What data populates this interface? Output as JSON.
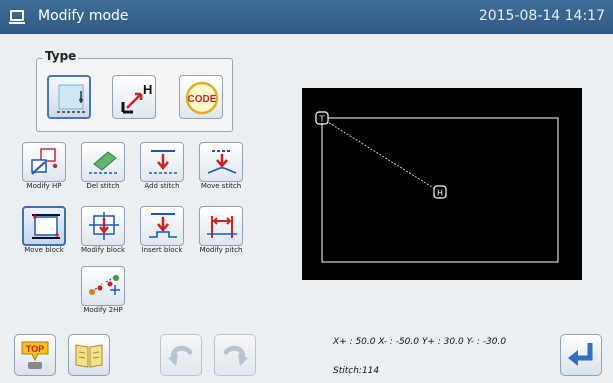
{
  "header": {
    "title": "Modify mode",
    "datetime": "2015-08-14 14:17"
  },
  "type_group": {
    "legend": "Type",
    "buttons": [
      {
        "icon": "stitch-data-icon",
        "selected": true
      },
      {
        "icon": "high-low-icon",
        "label": "H"
      },
      {
        "icon": "code-icon",
        "label": "CODE"
      }
    ]
  },
  "functions": [
    {
      "label": "Modify HP",
      "icon": "modify-hp-icon"
    },
    {
      "label": "Del stitch",
      "icon": "del-stitch-icon"
    },
    {
      "label": "Add stitch",
      "icon": "add-stitch-icon"
    },
    {
      "label": "Move stitch",
      "icon": "move-stitch-icon"
    },
    {
      "label": "Move block",
      "icon": "move-block-icon",
      "selected": true
    },
    {
      "label": "Modify block",
      "icon": "modify-block-icon"
    },
    {
      "label": "Insert block",
      "icon": "insert-block-icon"
    },
    {
      "label": "Modify pitch",
      "icon": "modify-pitch-icon"
    },
    {
      "label": "Modify 2HP",
      "icon": "modify-2hp-icon"
    }
  ],
  "preview": {
    "start_marker": "T",
    "end_marker": "H"
  },
  "stats": {
    "coords": "X+ : 50.0   X- : -50.0   Y+ : 30.0   Y- : -30.0",
    "stitch": "Stitch:114"
  },
  "bottom": {
    "top_label": "TOP",
    "icons": [
      "top-icon",
      "book-icon",
      "undo-icon",
      "redo-icon",
      "enter-icon"
    ]
  },
  "colors": {
    "titlebar": "#356290",
    "accent": "#3f6fb8",
    "preview_bg": "#000000"
  }
}
